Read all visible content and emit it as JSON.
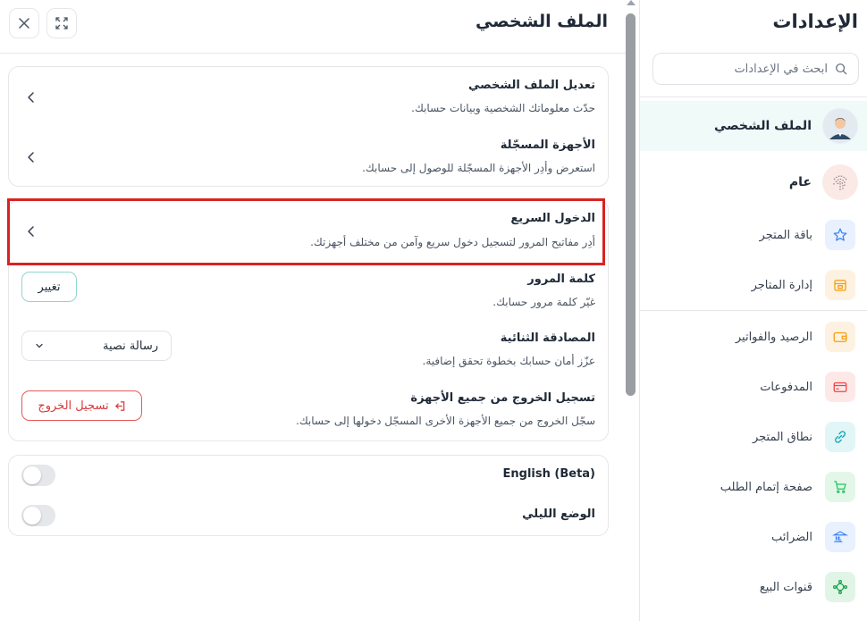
{
  "sidebar": {
    "title": "الإعدادات",
    "search_placeholder": "ابحث في الإعدادات",
    "items": [
      {
        "label": "الملف الشخصي",
        "icon": "user-avatar-icon",
        "active": true
      },
      {
        "label": "عام",
        "icon": "fingerprint-icon"
      },
      {
        "label": "باقة المتجر",
        "icon": "star-icon",
        "color": "#3b82f6"
      },
      {
        "label": "إدارة المتاجر",
        "icon": "store-icon",
        "color": "#f59e0b"
      },
      {
        "label": "الرصيد والفواتير",
        "icon": "wallet-icon",
        "color": "#f59e0b"
      },
      {
        "label": "المدفوعات",
        "icon": "credit-card-icon",
        "color": "#ef4444"
      },
      {
        "label": "نطاق المتجر",
        "icon": "link-icon",
        "color": "#0ea5b7"
      },
      {
        "label": "صفحة إتمام الطلب",
        "icon": "cart-icon",
        "color": "#22c55e"
      },
      {
        "label": "الضرائب",
        "icon": "tax-bank-icon",
        "color": "#3b82f6"
      },
      {
        "label": "قنوات البيع",
        "icon": "channels-icon",
        "color": "#16a34a"
      }
    ]
  },
  "main": {
    "title": "الملف الشخصي",
    "profile_card": {
      "edit_title": "تعديل الملف الشخصي",
      "edit_desc": "حدّث معلوماتك الشخصية وبيانات حسابك.",
      "devices_title": "الأجهزة المسجّلة",
      "devices_desc": "استعرض وأدِر الأجهزة المسجّلة للوصول إلى حسابك."
    },
    "security": {
      "quick_title": "الدخول السريع",
      "quick_desc": "أدِر مفاتيح المرور لتسجيل دخول سريع وآمن من مختلف أجهزتك.",
      "password_title": "كلمة المرور",
      "password_desc": "غيّر كلمة مرور حسابك.",
      "password_button": "تغيير",
      "twofa_title": "المصادقة الثنائية",
      "twofa_desc": "عزّز أمان حسابك بخطوة تحقق إضافية.",
      "twofa_value": "رسالة نصية",
      "logout_title": "تسجيل الخروج من جميع الأجهزة",
      "logout_desc": "سجّل الخروج من جميع الأجهزة الأخرى المسجّل دخولها إلى حسابك.",
      "logout_button": "تسجيل الخروج"
    },
    "prefs": {
      "english_label": "English (Beta)",
      "english_on": false,
      "dark_label": "الوضع الليلي",
      "dark_on": false
    }
  },
  "colors": {
    "accent_teal": "#8fd6ce",
    "danger": "#d63939",
    "highlight": "#d92323",
    "active_bg": "#f0faf8"
  }
}
